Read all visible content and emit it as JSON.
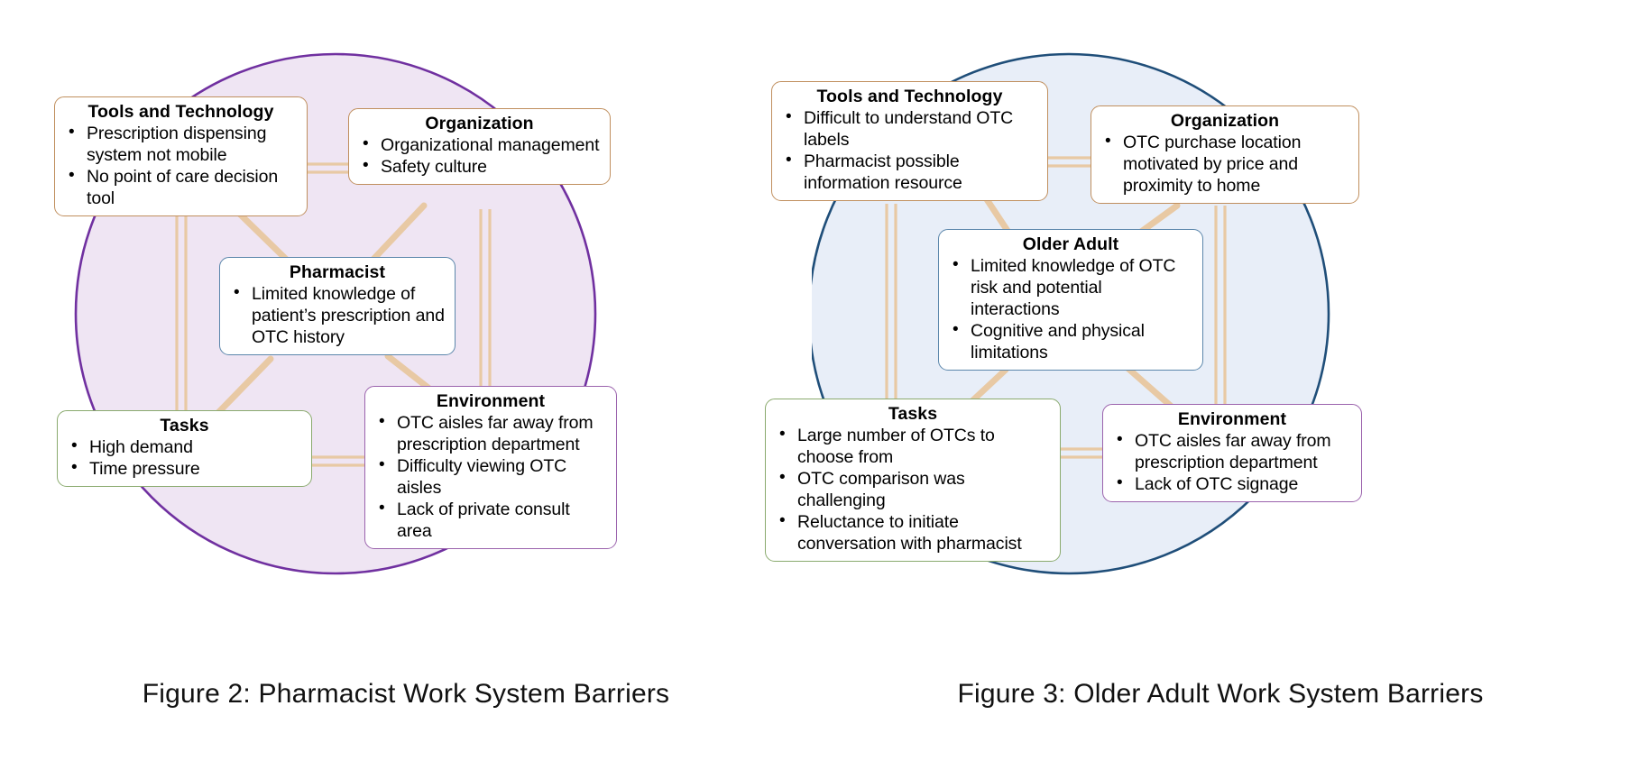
{
  "figures": [
    {
      "id": "pharmacist",
      "caption": "Figure 2: Pharmacist Work System Barriers",
      "circle": {
        "fill": "#efe5f3",
        "stroke": "#7030a0"
      },
      "boxes": {
        "tools": {
          "title": "Tools and Technology",
          "border_color": "#c08f5e",
          "items": [
            "Prescription dispensing system not mobile",
            "No point of care decision tool"
          ]
        },
        "organization": {
          "title": "Organization",
          "border_color": "#c08f5e",
          "items": [
            "Organizational management",
            "Safety culture"
          ]
        },
        "person": {
          "title": "Pharmacist",
          "border_color": "#5b86ab",
          "items": [
            "Limited knowledge of patient’s prescription and OTC history"
          ]
        },
        "tasks": {
          "title": "Tasks",
          "border_color": "#8aaa6e",
          "items": [
            "High demand",
            "Time pressure"
          ]
        },
        "environment": {
          "title": "Environment",
          "border_color": "#9b63ad",
          "items": [
            "OTC aisles far away from prescription department",
            "Difficulty viewing OTC aisles",
            "Lack of private consult area"
          ]
        }
      }
    },
    {
      "id": "olderadult",
      "caption": "Figure 3: Older Adult Work System Barriers",
      "circle": {
        "fill": "#e8eef8",
        "stroke": "#1f4e79"
      },
      "boxes": {
        "tools": {
          "title": "Tools and Technology",
          "border_color": "#c08f5e",
          "items": [
            "Difficult to understand OTC labels",
            "Pharmacist possible information resource"
          ]
        },
        "organization": {
          "title": "Organization",
          "border_color": "#c08f5e",
          "items": [
            "OTC purchase location motivated by price and proximity to home"
          ]
        },
        "person": {
          "title": "Older Adult",
          "border_color": "#5b86ab",
          "items": [
            "Limited knowledge of OTC risk and potential interactions",
            "Cognitive and physical limitations"
          ]
        },
        "tasks": {
          "title": "Tasks",
          "border_color": "#8aaa6e",
          "items": [
            "Large number of OTCs to choose from",
            "OTC comparison was challenging",
            "Reluctance to initiate conversation with pharmacist"
          ]
        },
        "environment": {
          "title": "Environment",
          "border_color": "#9b63ad",
          "items": [
            "OTC aisles far away from prescription department",
            "Lack of OTC signage"
          ]
        }
      }
    }
  ],
  "connector_color": "#e8c9a4"
}
